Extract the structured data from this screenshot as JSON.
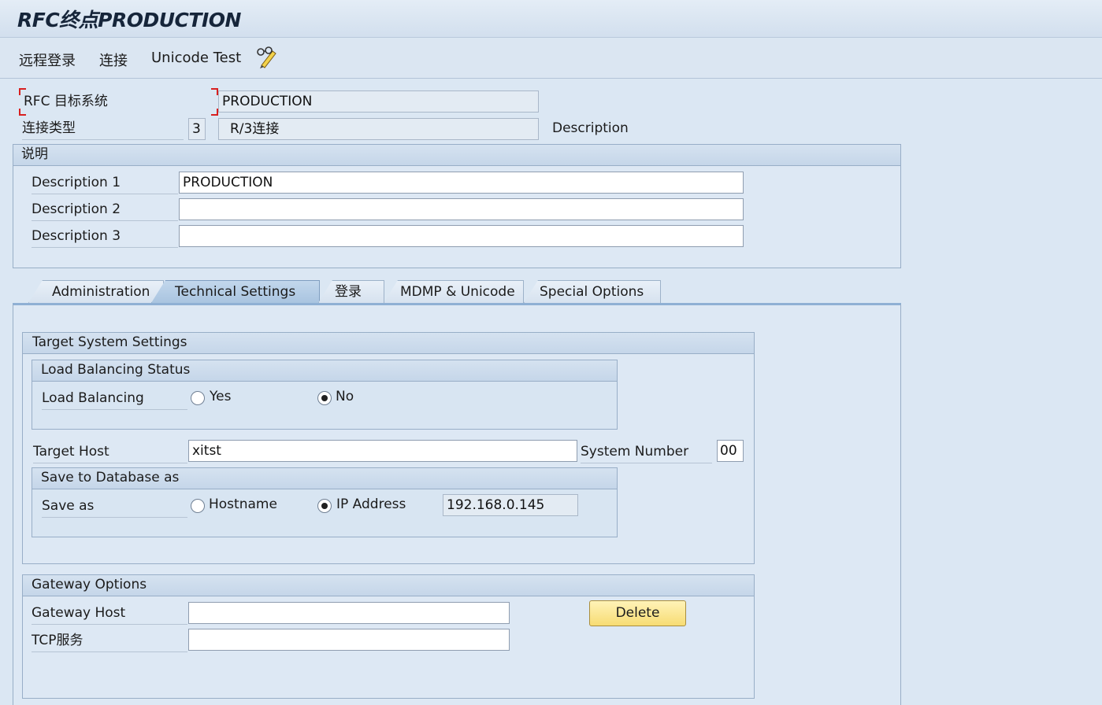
{
  "window": {
    "title": "RFC终点PRODUCTION"
  },
  "toolbar": {
    "items": [
      "远程登录",
      "连接",
      "Unicode Test"
    ],
    "edit_icon": "pencil-glasses-icon"
  },
  "header": {
    "rfc_target_label": "RFC 目标系统",
    "rfc_target_value": "PRODUCTION",
    "conn_type_label": "连接类型",
    "conn_type_code": "3",
    "conn_type_text": "R/3连接",
    "description_label": "Description"
  },
  "description_group": {
    "title": "说明",
    "rows": [
      {
        "label": "Description 1",
        "value": "PRODUCTION"
      },
      {
        "label": "Description 2",
        "value": ""
      },
      {
        "label": "Description 3",
        "value": ""
      }
    ]
  },
  "tabs": [
    {
      "label": "Administration",
      "active": false
    },
    {
      "label": "Technical Settings",
      "active": true
    },
    {
      "label": "登录",
      "active": false
    },
    {
      "label": "MDMP & Unicode",
      "active": false
    },
    {
      "label": "Special Options",
      "active": false
    }
  ],
  "target_system": {
    "title": "Target System Settings",
    "load_balancing_group": "Load Balancing Status",
    "load_balancing_label": "Load Balancing",
    "lb_yes": "Yes",
    "lb_no": "No",
    "lb_selected": "No",
    "target_host_label": "Target Host",
    "target_host_value": "xitst",
    "system_number_label": "System Number",
    "system_number_value": "00",
    "save_group": "Save to Database as",
    "save_as_label": "Save as",
    "save_hostname": "Hostname",
    "save_ip": "IP Address",
    "save_selected": "IP Address",
    "ip_value": "192.168.0.145"
  },
  "gateway": {
    "title": "Gateway Options",
    "host_label": "Gateway Host",
    "host_value": "",
    "tcp_label": "TCP服务",
    "tcp_value": "",
    "delete_label": "Delete"
  }
}
